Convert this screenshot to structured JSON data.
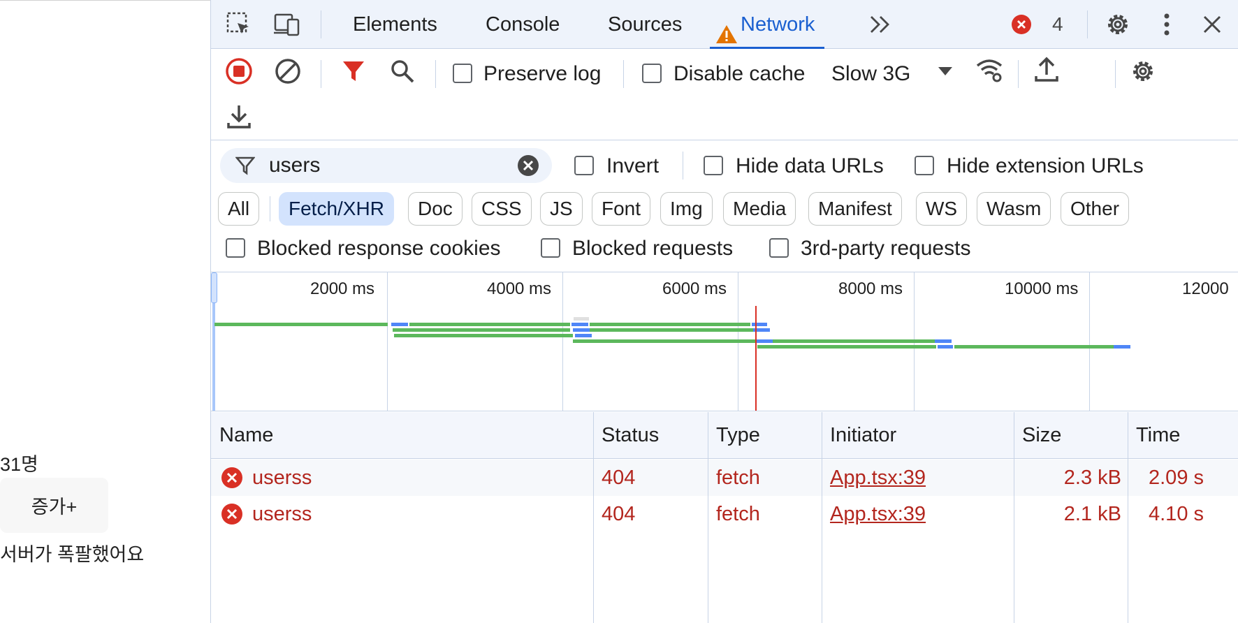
{
  "page": {
    "count_text": "31명",
    "increase_button": "증가+",
    "error_text": "서버가 폭팔했어요"
  },
  "devtools": {
    "tabs": [
      {
        "label": "Elements"
      },
      {
        "label": "Console"
      },
      {
        "label": "Sources"
      },
      {
        "label": "Network",
        "active": true,
        "warning": true
      }
    ],
    "error_count": "4",
    "toolbar": {
      "preserve_log": "Preserve log",
      "disable_cache": "Disable cache",
      "throttling": "Slow 3G"
    },
    "filter": {
      "value": "users",
      "invert": "Invert",
      "hide_data_urls": "Hide data URLs",
      "hide_extension_urls": "Hide extension URLs",
      "types": [
        "All",
        "Fetch/XHR",
        "Doc",
        "CSS",
        "JS",
        "Font",
        "Img",
        "Media",
        "Manifest",
        "WS",
        "Wasm",
        "Other"
      ],
      "active_type": "Fetch/XHR",
      "blocked_response_cookies": "Blocked response cookies",
      "blocked_requests": "Blocked requests",
      "third_party_requests": "3rd-party requests"
    },
    "overview": {
      "ticks": [
        "2000 ms",
        "4000 ms",
        "6000 ms",
        "8000 ms",
        "10000 ms",
        "12000"
      ]
    },
    "table": {
      "columns": [
        "Name",
        "Status",
        "Type",
        "Initiator",
        "Size",
        "Time"
      ],
      "rows": [
        {
          "name": "userss",
          "status": "404",
          "type": "fetch",
          "initiator": "App.tsx:39",
          "size": "2.3 kB",
          "time": "2.09 s"
        },
        {
          "name": "userss",
          "status": "404",
          "type": "fetch",
          "initiator": "App.tsx:39",
          "size": "2.1 kB",
          "time": "4.10 s"
        }
      ]
    },
    "colors": {
      "accent": "#1a5fd0",
      "error": "#b3261e",
      "record": "#d93025",
      "waiting": "#5cb85c",
      "download": "#4f86f7"
    }
  }
}
